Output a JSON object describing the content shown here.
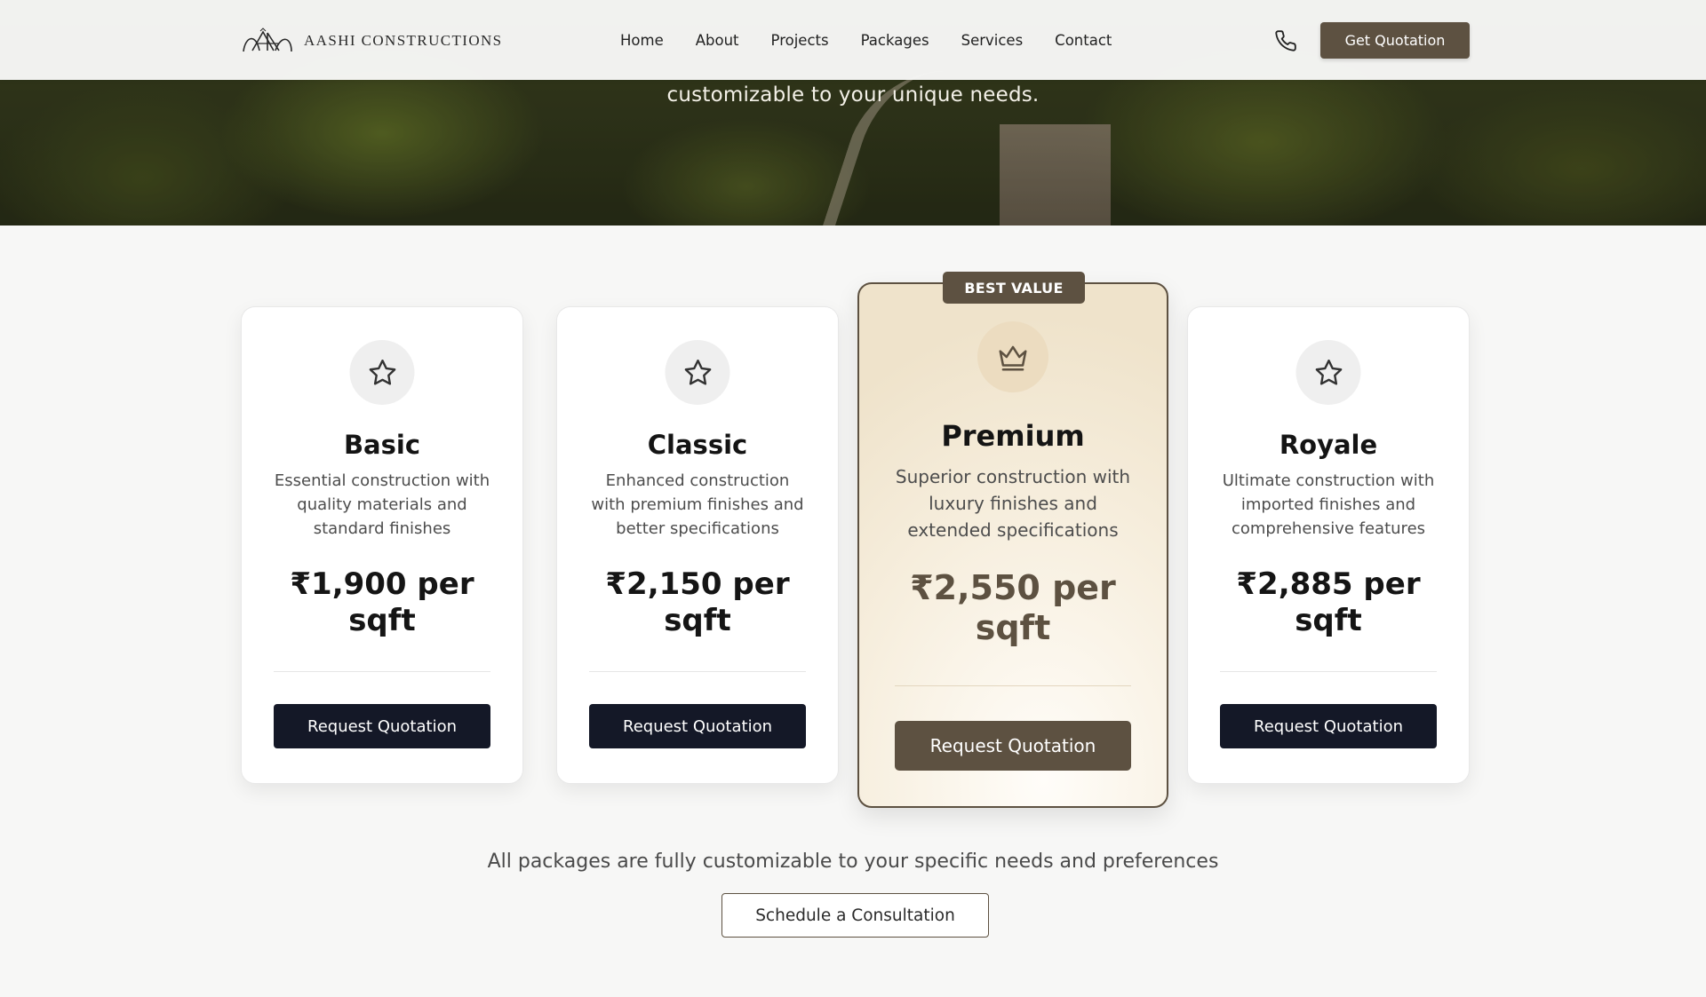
{
  "brand": {
    "name": "Aashi Constructions",
    "colors": {
      "accent": "#5d5141",
      "dark_button": "#141827",
      "page_bg": "#f7f7f6",
      "featured_bg": "#f7efdf"
    }
  },
  "nav": {
    "links": [
      "Home",
      "About",
      "Projects",
      "Packages",
      "Services",
      "Contact"
    ],
    "phone_icon": "phone-icon",
    "cta_label": "Get Quotation"
  },
  "hero": {
    "subtitle": "customizable to your unique needs."
  },
  "packages": [
    {
      "icon": "star-icon",
      "name": "Basic",
      "description": "Essential construction with quality materials and standard finishes",
      "price": "₹1,900 per sqft",
      "button_label": "Request Quotation"
    },
    {
      "icon": "star-icon",
      "name": "Classic",
      "description": "Enhanced construction with premium finishes and better specifications",
      "price": "₹2,150 per sqft",
      "button_label": "Request Quotation"
    },
    {
      "icon": "crown-icon",
      "name": "Premium",
      "badge": "BEST VALUE",
      "description": "Superior construction with luxury finishes and extended specifications",
      "price": "₹2,550 per sqft",
      "button_label": "Request Quotation"
    },
    {
      "icon": "star-icon",
      "name": "Royale",
      "description": "Ultimate construction with imported finishes and comprehensive features",
      "price": "₹2,885 per sqft",
      "button_label": "Request Quotation"
    }
  ],
  "footer": {
    "note": "All packages are fully customizable to your specific needs and preferences",
    "consult_label": "Schedule a Consultation"
  }
}
